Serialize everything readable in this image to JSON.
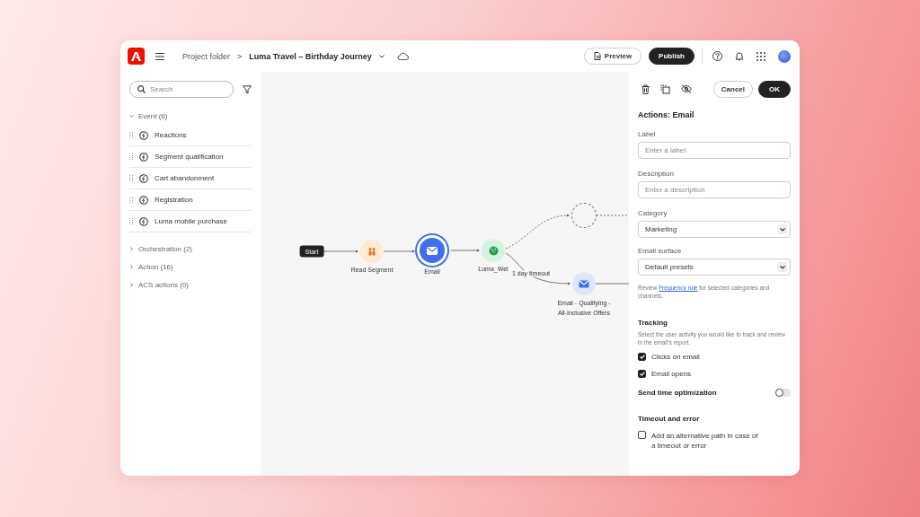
{
  "header": {
    "breadcrumb_parent": "Project folder",
    "separator": ">",
    "journey_title": "Luma Travel – Birthday Journey",
    "preview_button": "Preview",
    "publish_button": "Publish"
  },
  "sidebar": {
    "search": {
      "placeholder": "Search"
    },
    "groups": [
      {
        "label": "Event (6)",
        "expanded": true,
        "items": [
          "Reactions",
          "Segment qualification",
          "Cart abandonment",
          "Registration",
          "Luma mobile purchase"
        ]
      },
      {
        "label": "Orchestration (2)",
        "expanded": false
      },
      {
        "label": "Action (16)",
        "expanded": false
      },
      {
        "label": "ACS actions (0)",
        "expanded": false
      }
    ]
  },
  "canvas": {
    "nodes": [
      {
        "kind": "start",
        "label": "Start",
        "selected": false
      },
      {
        "kind": "segment",
        "label": "Read Segment",
        "selected": false
      },
      {
        "kind": "email",
        "label": "Email",
        "selected": true
      },
      {
        "kind": "web",
        "label": "Luma_Wel",
        "selected": false
      },
      {
        "kind": "placeholder",
        "selected": false
      },
      {
        "kind": "email",
        "label": "Email - Qualifying - All-Inclusive Offers",
        "selected": false
      }
    ],
    "edge_label": "1 day timeout"
  },
  "panel": {
    "cancel_button": "Cancel",
    "ok_button": "OK",
    "title": "Actions: Email",
    "fields": [
      {
        "kind": "text",
        "label": "Label",
        "placeholder": "Enter a label"
      },
      {
        "kind": "text",
        "label": "Description",
        "placeholder": "Enter a description"
      },
      {
        "kind": "select",
        "label": "Category",
        "value": "Marketing"
      },
      {
        "kind": "select",
        "label": "Email surface",
        "value": "Default presets"
      }
    ],
    "hint": {
      "before": "Review ",
      "link": "Frequency rule",
      "after": " for selected categories and channels."
    },
    "tracking": {
      "heading": "Tracking",
      "description": "Select the user activity you would like to track and review in the email's report.",
      "options": [
        {
          "label": "Clicks on email",
          "checked": true
        },
        {
          "label": "Email opens",
          "checked": true
        }
      ]
    },
    "send_time": {
      "label": "Send time optimization",
      "on": false
    },
    "timeout": {
      "heading": "Timeout and error",
      "option": {
        "label": "Add an alternative path in case of a timeout or error",
        "checked": false
      }
    }
  }
}
